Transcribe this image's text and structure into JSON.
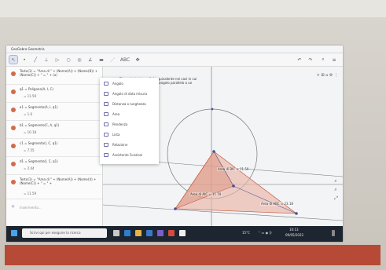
{
  "window": {
    "title": "GeoGebra Geometria"
  },
  "toolbar": {
    "abc_label": "ABC",
    "undo_icon": "undo-icon",
    "redo_icon": "redo-icon"
  },
  "algebra": {
    "items": [
      {
        "text": "Testo(1) = \"Area di \" + (Nome(A)) + (Nome(B)) + (Nome(C)) + \" = \" + (a)",
        "value": ""
      },
      {
        "text": "q1 = Poligono(A, I, C)",
        "value": "= 11.59"
      },
      {
        "text": "a1 = Segmento(A, I, q1)",
        "value": "= 1.6"
      },
      {
        "text": "b1 = Segmento(C, A, q1)",
        "value": "= 10.18"
      },
      {
        "text": "c1 = Segmento(I, C, q1)",
        "value": "= 7.55"
      },
      {
        "text": "d1 = Segmento(I, C, q1)",
        "value": "= 2.44"
      },
      {
        "text": "Testo(1) = \"Area di \" + (Nome(A)) + (Nome(I)) + (Nome(C)) + \" = \" +",
        "value": "= 11.59"
      }
    ],
    "input_label": "Inserimento..."
  },
  "menu": {
    "items": [
      "Angolo",
      "Angolo di data misura",
      "Distanza o lunghezza",
      "Area",
      "Pendenza",
      "Lista",
      "Relazione",
      "Assistente Funzioni"
    ]
  },
  "graphics": {
    "note": "Triangolo in dove ciò è equivalente nei casi in cui parte per il vertice del triangolo parallelo a un suo generata",
    "labels": {
      "area_bic": "Area di BIC = 11.59",
      "area_aic": "Area di AIC = 11.59",
      "area_abc": "Area di ABC = 23.18"
    }
  },
  "taskbar": {
    "search_placeholder": "Scrivi qui per eseguire la ricerca",
    "weather": "15°C",
    "time": "10:13",
    "date": "09/05/2022"
  }
}
